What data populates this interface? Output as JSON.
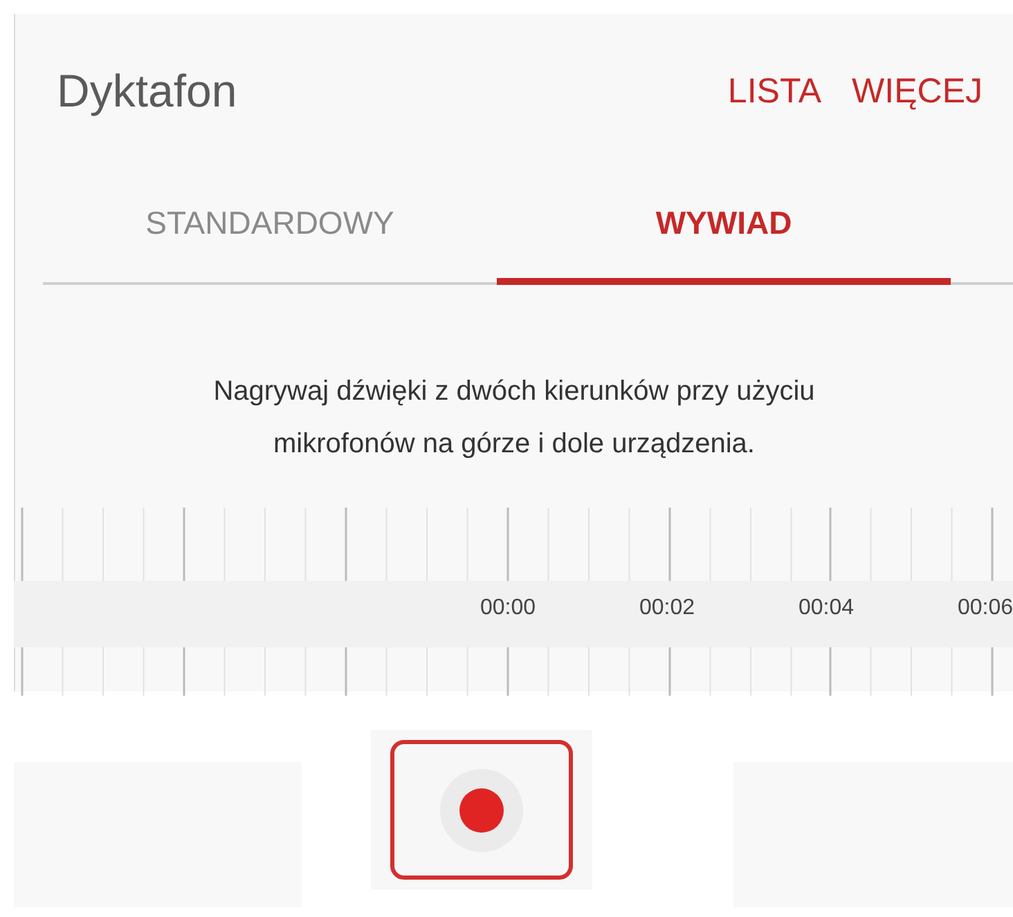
{
  "app_bar": {
    "title": "Dyktafon",
    "actions": [
      "LISTA",
      "WIĘCEJ"
    ]
  },
  "tabs": [
    {
      "label": "STANDARDOWY",
      "selected": false
    },
    {
      "label": "WYWIAD",
      "selected": true
    }
  ],
  "description": "Nagrywaj dźwięki z dwóch kierunków przy użyciu mikrofonów na górze i dole urządzenia.",
  "timeline": {
    "labels": [
      "00:00",
      "00:02",
      "00:04",
      "00:06"
    ]
  }
}
